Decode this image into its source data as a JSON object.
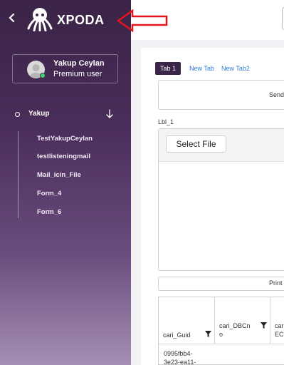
{
  "app": {
    "brand": "XPODA"
  },
  "user": {
    "name": "Yakup Ceylan",
    "role": "Premium user"
  },
  "sidebar": {
    "section_label": "Yakup",
    "items": [
      {
        "label": "TestYakupCeylan"
      },
      {
        "label": "testlisteningmail"
      },
      {
        "label": "Mail_icin_File"
      },
      {
        "label": "Form_4"
      },
      {
        "label": "Form_6"
      }
    ]
  },
  "tabs": [
    {
      "label": "Tab 1",
      "active": true
    },
    {
      "label": "New Tab",
      "active": false
    },
    {
      "label": "New Tab2",
      "active": false
    }
  ],
  "form": {
    "send_label": "Send",
    "lbl_1": "Lbl_1",
    "select_file_label": "Select File",
    "print_label": "Print"
  },
  "grid": {
    "columns": [
      {
        "header": "cari_Guid"
      },
      {
        "header_line1": "cari_DBCn",
        "header_line2": "o"
      },
      {
        "header_line1": "cari",
        "header_line2": "ECi"
      }
    ],
    "first_cell": [
      "0995fbb4-",
      "3e23-ea11-"
    ]
  },
  "colors": {
    "sidebar_top": "#3b2447",
    "sidebar_bottom": "#a58fb4",
    "active_tab": "#3a2548",
    "link": "#2e7bd6",
    "annotation_arrow": "#e3141b",
    "online": "#3fd36b"
  },
  "icons": {
    "collapse": "chevron-left-icon",
    "logo": "octopus-logo-icon",
    "status": "online-dot-icon",
    "section": "circle-icon",
    "expand": "arrow-down-icon",
    "filter": "filter-icon",
    "annotation": "red-arrow-icon"
  }
}
